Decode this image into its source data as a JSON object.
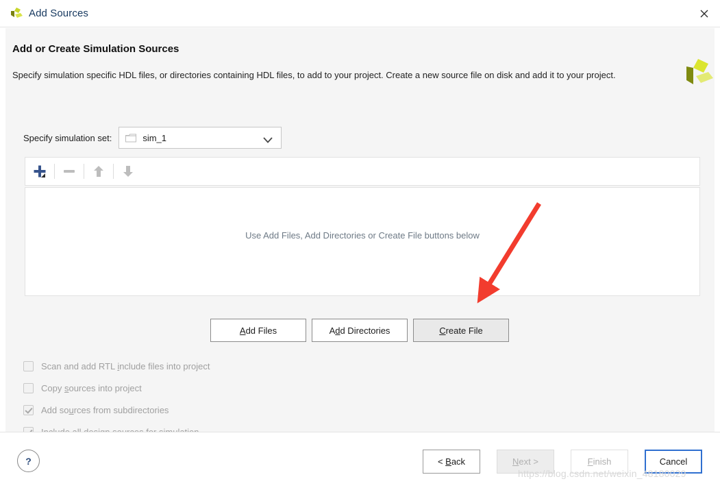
{
  "window": {
    "title": "Add Sources",
    "logo_icon": "xilinx-vivado-logo",
    "close_icon": "close-icon"
  },
  "header": {
    "title": "Add or Create Simulation Sources",
    "description": "Specify simulation specific HDL files, or directories containing HDL files, to add to your project. Create a new source file on disk and add it to your project.",
    "brand_icon": "xilinx-logo"
  },
  "simulation_set": {
    "label": "Specify simulation set:",
    "value": "sim_1",
    "folder_icon": "folder-icon",
    "caret_icon": "chevron-down-icon",
    "options": [
      "sim_1"
    ]
  },
  "toolbar": {
    "add_icon": "plus-icon",
    "remove_icon": "minus-icon",
    "move_up_icon": "arrow-up-icon",
    "move_down_icon": "arrow-down-icon"
  },
  "file_list": {
    "empty_message": "Use Add Files, Add Directories or Create File buttons below",
    "rows": []
  },
  "actions": [
    {
      "label_pre": "A",
      "label_key": "A",
      "label_post": "dd Files",
      "name": "add-files-button",
      "state": "normal"
    },
    {
      "label_pre": "A",
      "label_key": "d",
      "label_post": "d Directories",
      "name": "add-directories-button",
      "state": "normal"
    },
    {
      "label_pre": "",
      "label_key": "C",
      "label_post": "reate File",
      "name": "create-file-button",
      "state": "hovered"
    }
  ],
  "action_labels": {
    "add_files": "Add Files",
    "add_directories": "Add Directories",
    "create_file": "Create File"
  },
  "options": [
    {
      "label_a": "Scan and add RTL ",
      "label_key": "i",
      "label_b": "nclude files into project",
      "checked": false,
      "enabled": false,
      "name": "scan-rtl-include-checkbox"
    },
    {
      "label_a": "Copy ",
      "label_key": "s",
      "label_b": "ources into project",
      "checked": false,
      "enabled": false,
      "name": "copy-sources-checkbox"
    },
    {
      "label_a": "Add so",
      "label_key": "u",
      "label_b": "rces from subdirectories",
      "checked": true,
      "enabled": false,
      "name": "add-sources-subdirectories-checkbox"
    },
    {
      "label_a": "Include all design s",
      "label_key": "o",
      "label_b": "urces for simulation",
      "checked": true,
      "enabled": false,
      "name": "include-design-sources-checkbox"
    }
  ],
  "footer": {
    "help_label": "?",
    "back": {
      "pre": "< ",
      "key": "B",
      "post": "ack",
      "state": "normal"
    },
    "next": {
      "pre": "",
      "key": "N",
      "post": "ext >",
      "state": "disabled-grey"
    },
    "finish": {
      "pre": "",
      "key": "F",
      "post": "inish",
      "state": "disabled-white"
    },
    "cancel": {
      "pre": "",
      "key": "",
      "post": "Cancel",
      "state": "focused"
    }
  },
  "annotation": {
    "arrow_color": "#f23c2e",
    "watermark": "https://blog.csdn.net/weixin_48180029"
  },
  "colors": {
    "panel_bg": "#f5f5f5",
    "accent_blue": "#2f6fd0",
    "title_blue": "#15375e",
    "logo_green": "#c8d62b",
    "logo_dark": "#7a8211"
  }
}
